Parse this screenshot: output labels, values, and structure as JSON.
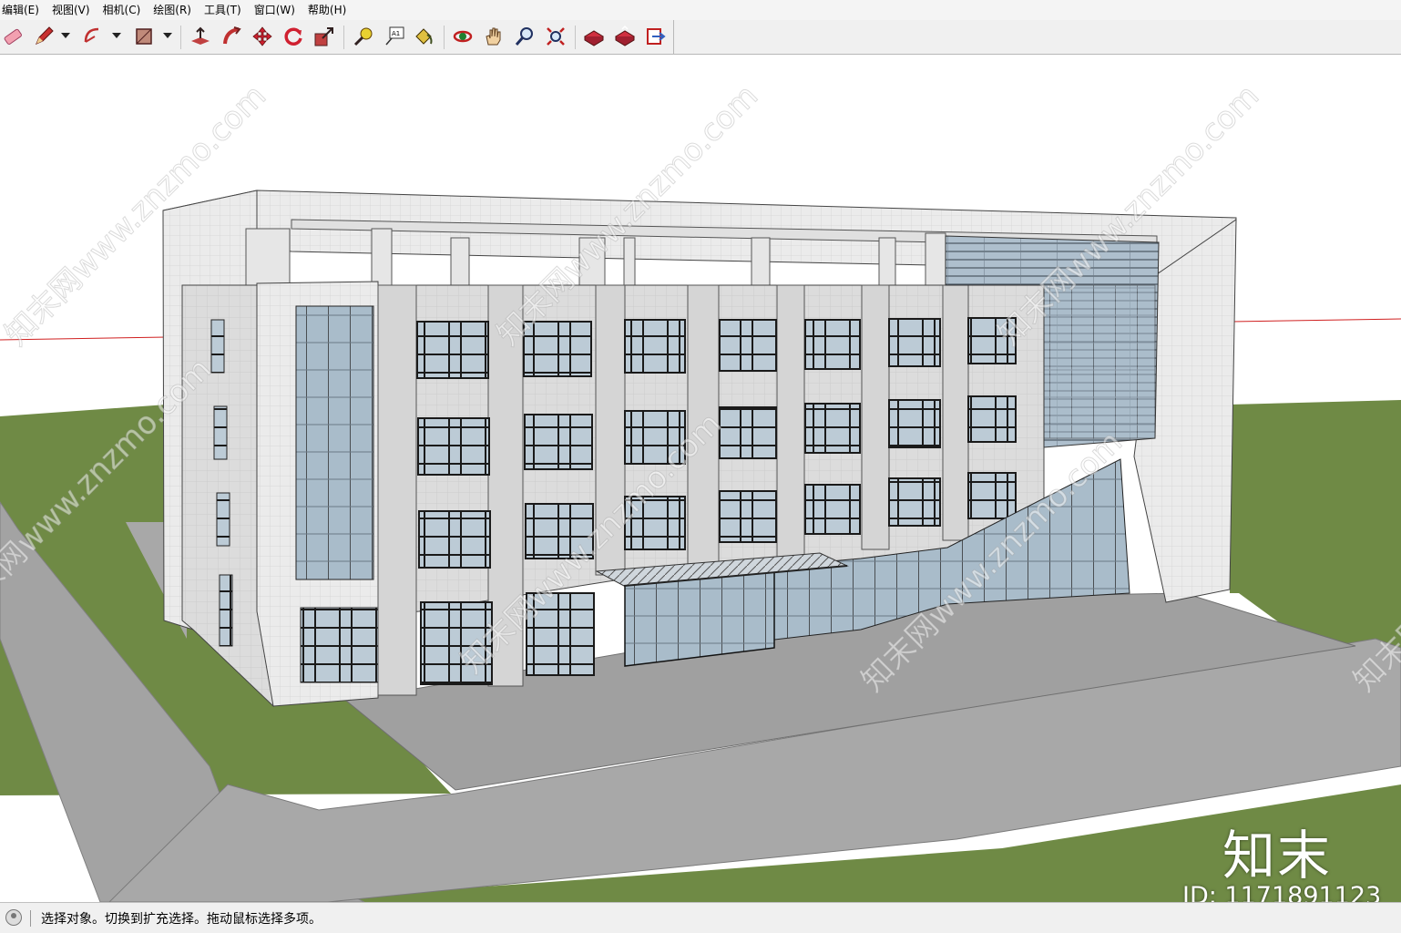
{
  "menu": {
    "items": [
      "编辑(E)",
      "视图(V)",
      "相机(C)",
      "绘图(R)",
      "工具(T)",
      "窗口(W)",
      "帮助(H)"
    ]
  },
  "toolbar": {
    "tools": [
      "eraser-icon",
      "pencil-icon",
      "arc-icon",
      "rectangle-icon",
      "push-pull-icon",
      "follow-me-icon",
      "move-icon",
      "rotate-icon",
      "scale-icon",
      "tape-measure-icon",
      "text-icon",
      "paint-bucket-icon",
      "orbit-icon",
      "pan-icon",
      "zoom-icon",
      "zoom-extents-icon",
      "warehouse-icon",
      "share-model-icon",
      "extension-icon"
    ],
    "text_tool_label": "A1"
  },
  "status": {
    "text": "选择对象。切换到扩充选择。拖动鼠标选择多项。"
  },
  "watermark": {
    "logo": "知末",
    "id": "ID: 1171891123",
    "diagonal": "知末网www.znzmo.com"
  },
  "colors": {
    "grass": "#6f8a45",
    "road": "#a3a3a3",
    "facade": "#dcdcdc",
    "glass": "#b8c8d2",
    "axis_red": "#d02020"
  }
}
